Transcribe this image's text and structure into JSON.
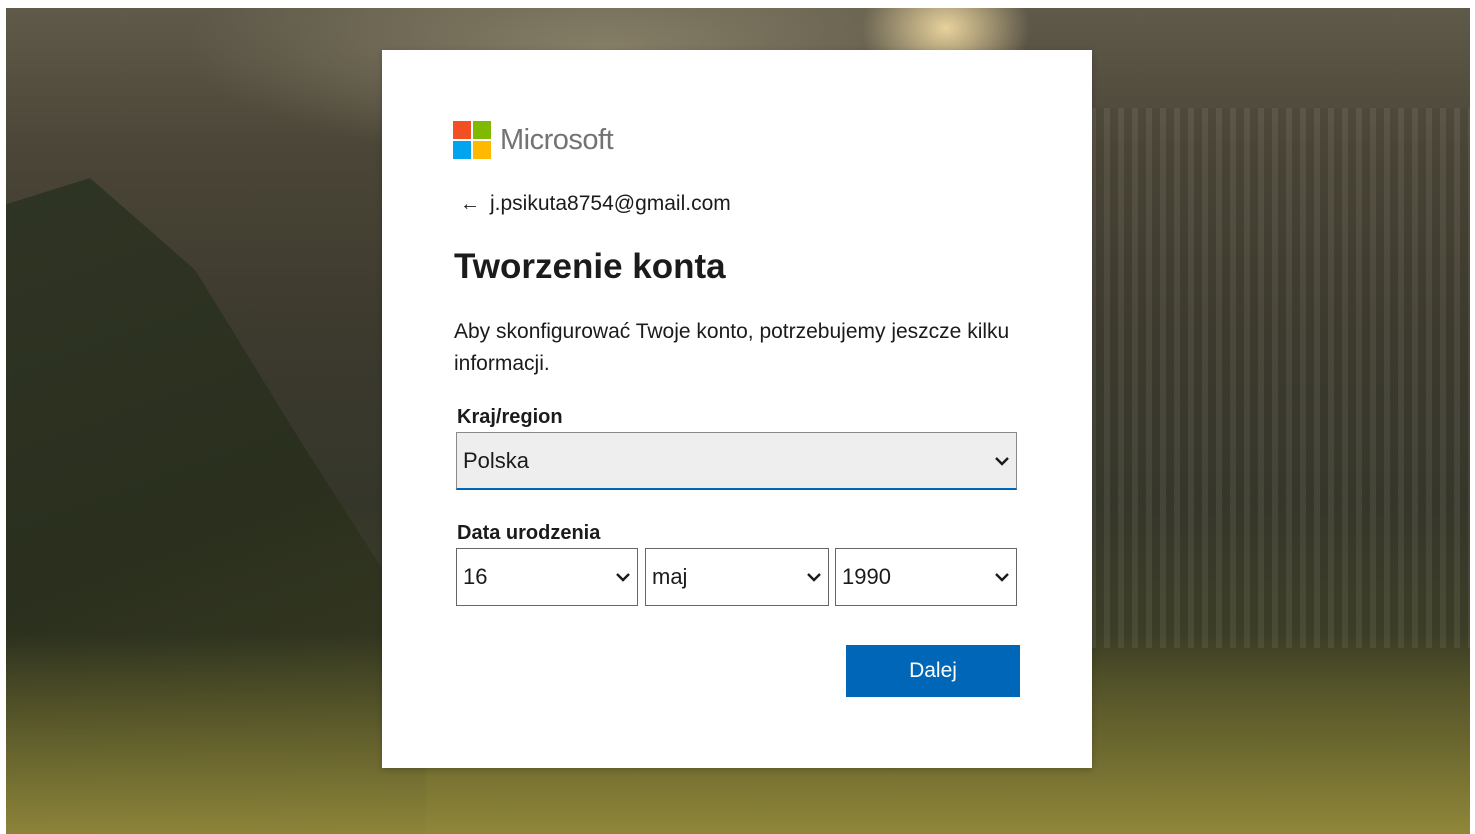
{
  "brand": {
    "name": "Microsoft",
    "logo_colors": [
      "#f25022",
      "#7fba00",
      "#00a4ef",
      "#ffb900"
    ]
  },
  "identity": {
    "email": "j.psikuta8754@gmail.com"
  },
  "page": {
    "title": "Tworzenie konta",
    "description": "Aby skonfigurować Twoje konto, potrzebujemy jeszcze kilku informacji."
  },
  "country": {
    "label": "Kraj/region",
    "value": "Polska"
  },
  "birthdate": {
    "label": "Data urodzenia",
    "day": "16",
    "month": "maj",
    "year": "1990"
  },
  "actions": {
    "next_label": "Dalej"
  },
  "colors": {
    "accent": "#0067b8",
    "text": "#1b1b1b"
  }
}
